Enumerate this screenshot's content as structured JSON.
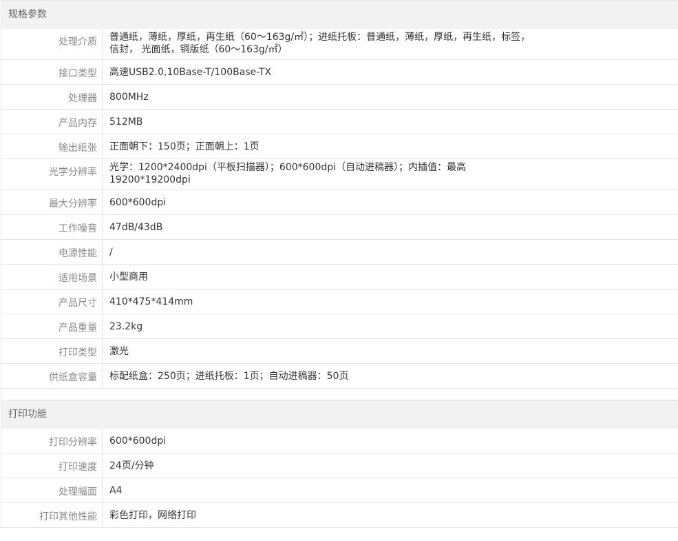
{
  "sections": [
    {
      "title": "规格参数",
      "rows": [
        {
          "label": "处理介质",
          "value": "普通纸，薄纸，厚纸，再生纸（60～163g/㎡）；进纸托板：普通纸，薄纸，厚纸，再生纸，标签，信封， 光面纸，铜版纸（60～163g/㎡）"
        },
        {
          "label": "接口类型",
          "value": "高速USB2.0,10Base-T/100Base-TX"
        },
        {
          "label": "处理器",
          "value": "800MHz"
        },
        {
          "label": "产品内存",
          "value": "512MB"
        },
        {
          "label": "输出纸张",
          "value": "正面朝下：150页；正面朝上：1页"
        },
        {
          "label": "光学分辨率",
          "value": "光学：1200*2400dpi（平板扫描器）；600*600dpi（自动进稿器）；内插值：最高19200*19200dpi"
        },
        {
          "label": "最大分辨率",
          "value": "600*600dpi"
        },
        {
          "label": "工作噪音",
          "value": "47dB/43dB"
        },
        {
          "label": "电源性能",
          "value": "/"
        },
        {
          "label": "适用场景",
          "value": "小型商用"
        },
        {
          "label": "产品尺寸",
          "value": "410*475*414mm"
        },
        {
          "label": "产品重量",
          "value": "23.2kg"
        },
        {
          "label": "打印类型",
          "value": "激光"
        },
        {
          "label": "供纸盒容量",
          "value": "标配纸盒：250页；进纸托板：1页；自动进稿器：50页"
        }
      ]
    },
    {
      "title": "打印功能",
      "rows": [
        {
          "label": "打印分辨率",
          "value": "600*600dpi"
        },
        {
          "label": "打印速度",
          "value": "24页/分钟"
        },
        {
          "label": "处理幅面",
          "value": "A4"
        },
        {
          "label": "打印其他性能",
          "value": "彩色打印，网络打印"
        }
      ]
    }
  ]
}
